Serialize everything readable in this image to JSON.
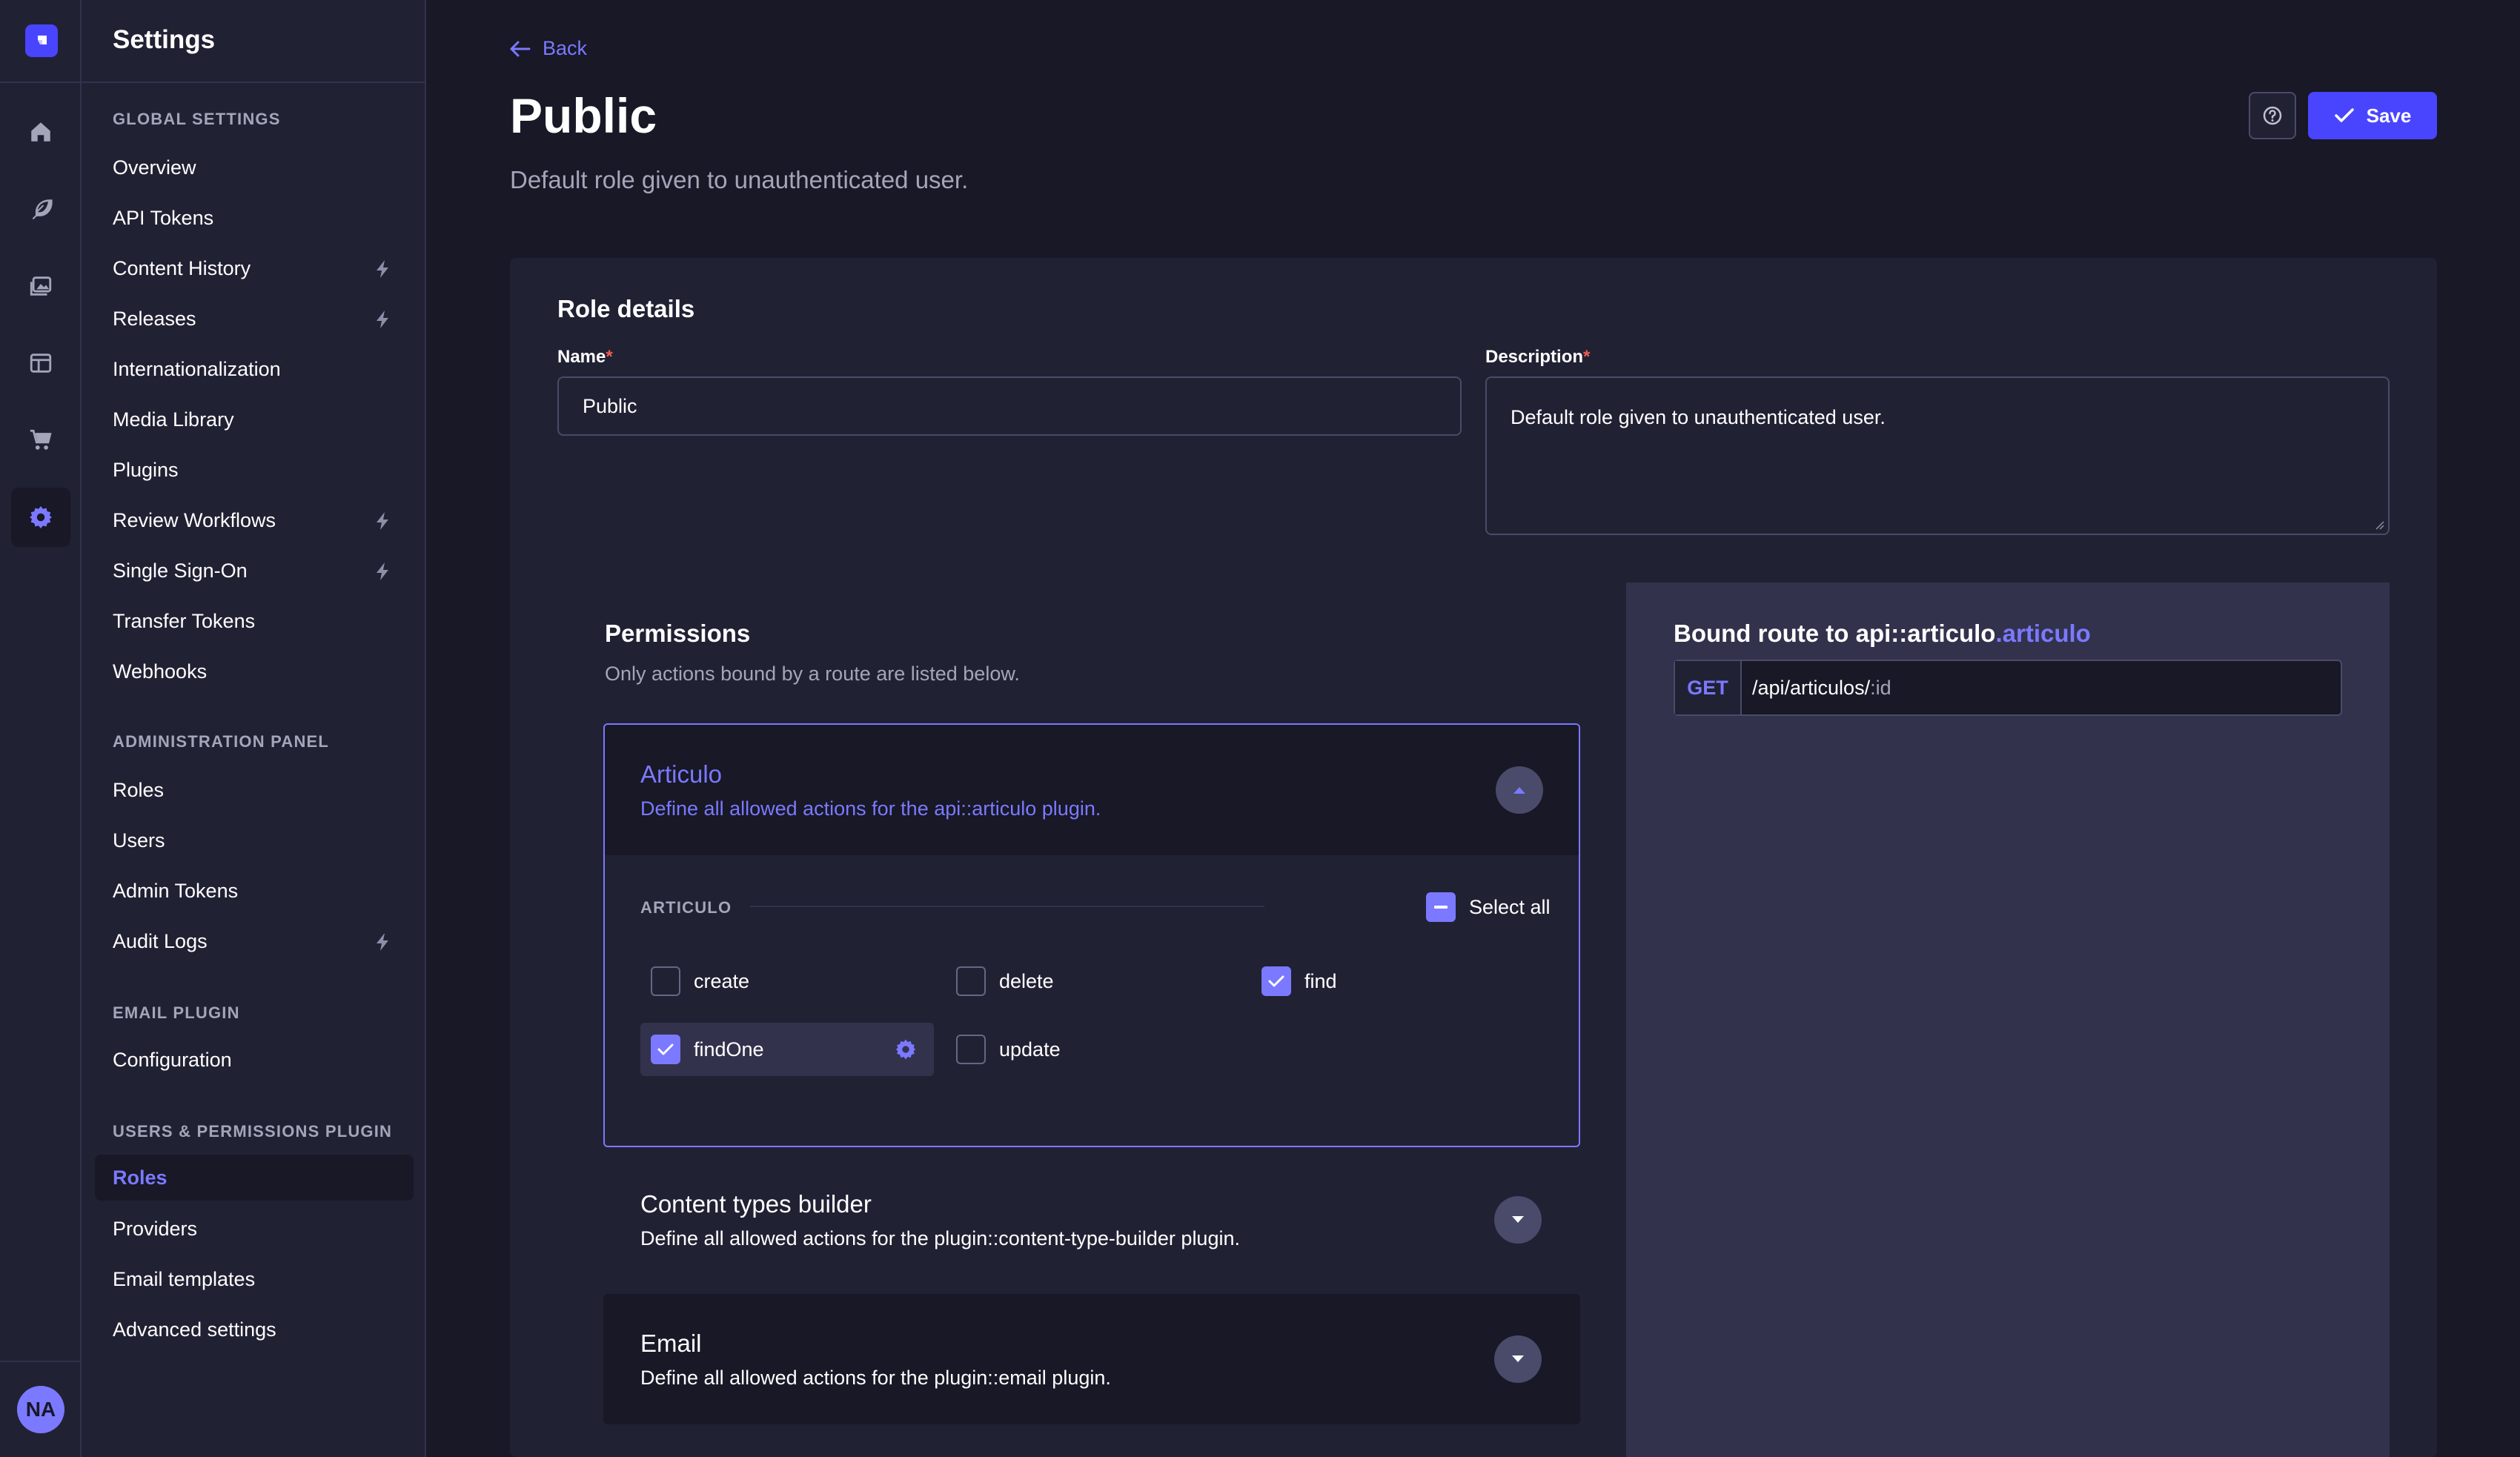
{
  "user": {
    "initials": "NA"
  },
  "settings_nav": {
    "title": "Settings",
    "sections": [
      {
        "label": "GLOBAL SETTINGS",
        "items": [
          {
            "label": "Overview"
          },
          {
            "label": "API Tokens"
          },
          {
            "label": "Content History",
            "badge": "lightning-icon"
          },
          {
            "label": "Releases",
            "badge": "lightning-icon"
          },
          {
            "label": "Internationalization"
          },
          {
            "label": "Media Library"
          },
          {
            "label": "Plugins"
          },
          {
            "label": "Review Workflows",
            "badge": "lightning-icon"
          },
          {
            "label": "Single Sign-On",
            "badge": "lightning-icon"
          },
          {
            "label": "Transfer Tokens"
          },
          {
            "label": "Webhooks"
          }
        ]
      },
      {
        "label": "ADMINISTRATION PANEL",
        "items": [
          {
            "label": "Roles"
          },
          {
            "label": "Users"
          },
          {
            "label": "Admin Tokens"
          },
          {
            "label": "Audit Logs",
            "badge": "lightning-icon"
          }
        ]
      },
      {
        "label": "EMAIL PLUGIN",
        "items": [
          {
            "label": "Configuration"
          }
        ]
      },
      {
        "label": "USERS & PERMISSIONS PLUGIN",
        "items": [
          {
            "label": "Roles",
            "active": true
          },
          {
            "label": "Providers"
          },
          {
            "label": "Email templates"
          },
          {
            "label": "Advanced settings"
          }
        ]
      }
    ]
  },
  "header": {
    "back_label": "Back",
    "title": "Public",
    "subtitle": "Default role given to unauthenticated user.",
    "save_label": "Save"
  },
  "role_details": {
    "title": "Role details",
    "name_label": "Name",
    "name_value": "Public",
    "description_label": "Description",
    "description_value": "Default role given to unauthenticated user.",
    "required_marker": "*"
  },
  "permissions": {
    "title": "Permissions",
    "subtitle": "Only actions bound by a route are listed below.",
    "groups": [
      {
        "name": "Articulo",
        "description": "Define all allowed actions for the api::articulo plugin.",
        "expanded": true,
        "section_label": "ARTICULO",
        "select_all_label": "Select all",
        "select_all_state": "indeterminate",
        "actions": [
          {
            "label": "create",
            "checked": false
          },
          {
            "label": "delete",
            "checked": false
          },
          {
            "label": "find",
            "checked": true
          },
          {
            "label": "findOne",
            "checked": true,
            "highlighted": true
          },
          {
            "label": "update",
            "checked": false
          }
        ]
      },
      {
        "name": "Content types builder",
        "description": "Define all allowed actions for the plugin::content-type-builder plugin.",
        "expanded": false
      },
      {
        "name": "Email",
        "description": "Define all allowed actions for the plugin::email plugin.",
        "expanded": false
      }
    ]
  },
  "bound_route": {
    "title_prefix": "Bound route to api::articulo",
    "title_highlight": ".articulo",
    "method": "GET",
    "path": "/api/articulos/",
    "path_param": ":id"
  },
  "colors": {
    "accent": "#7b79ff",
    "primary": "#4945ff",
    "background": "#181826",
    "surface": "#212134",
    "border": "#32324d",
    "muted_text": "#a5a5ba",
    "required": "#ee5e52"
  }
}
